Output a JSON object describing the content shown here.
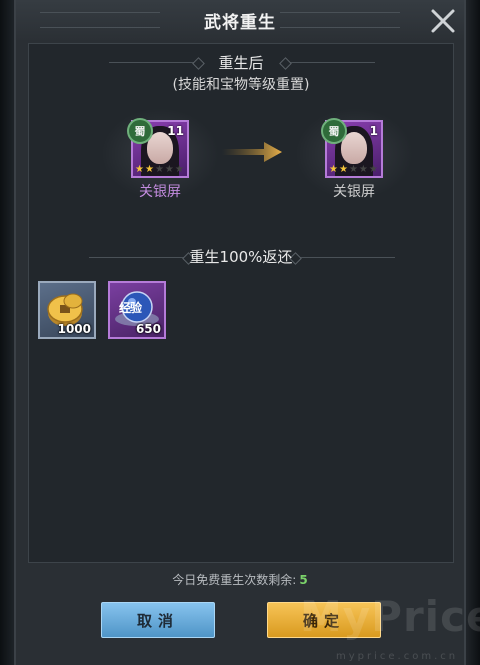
{
  "dialog": {
    "title": "武将重生",
    "close_icon": "close-icon"
  },
  "rebirth_preview": {
    "heading": "重生后",
    "subheading": "(技能和宝物等级重置)",
    "before": {
      "name": "关银屏",
      "faction": "蜀",
      "level": "11",
      "stars_filled": 2,
      "stars_total": 5
    },
    "after": {
      "name": "关银屏",
      "faction": "蜀",
      "level": "1",
      "stars_filled": 2,
      "stars_total": 5
    }
  },
  "returns": {
    "heading": "重生100%返还",
    "items": [
      {
        "icon": "coin-icon",
        "count": "1000"
      },
      {
        "icon": "exp-orb-icon",
        "label": "经验",
        "count": "650"
      }
    ]
  },
  "free_rebirths": {
    "label": "今日免费重生次数剩余:",
    "count": "5"
  },
  "buttons": {
    "cancel": "取消",
    "confirm": "确定"
  },
  "watermark": {
    "brand": "MyPrice",
    "url": "myprice.com.cn"
  },
  "colors": {
    "purple_quality": "#b57bd8",
    "cancel_button": "#5fa6d8",
    "confirm_button": "#eab13a",
    "free_count": "#7bd36a"
  }
}
